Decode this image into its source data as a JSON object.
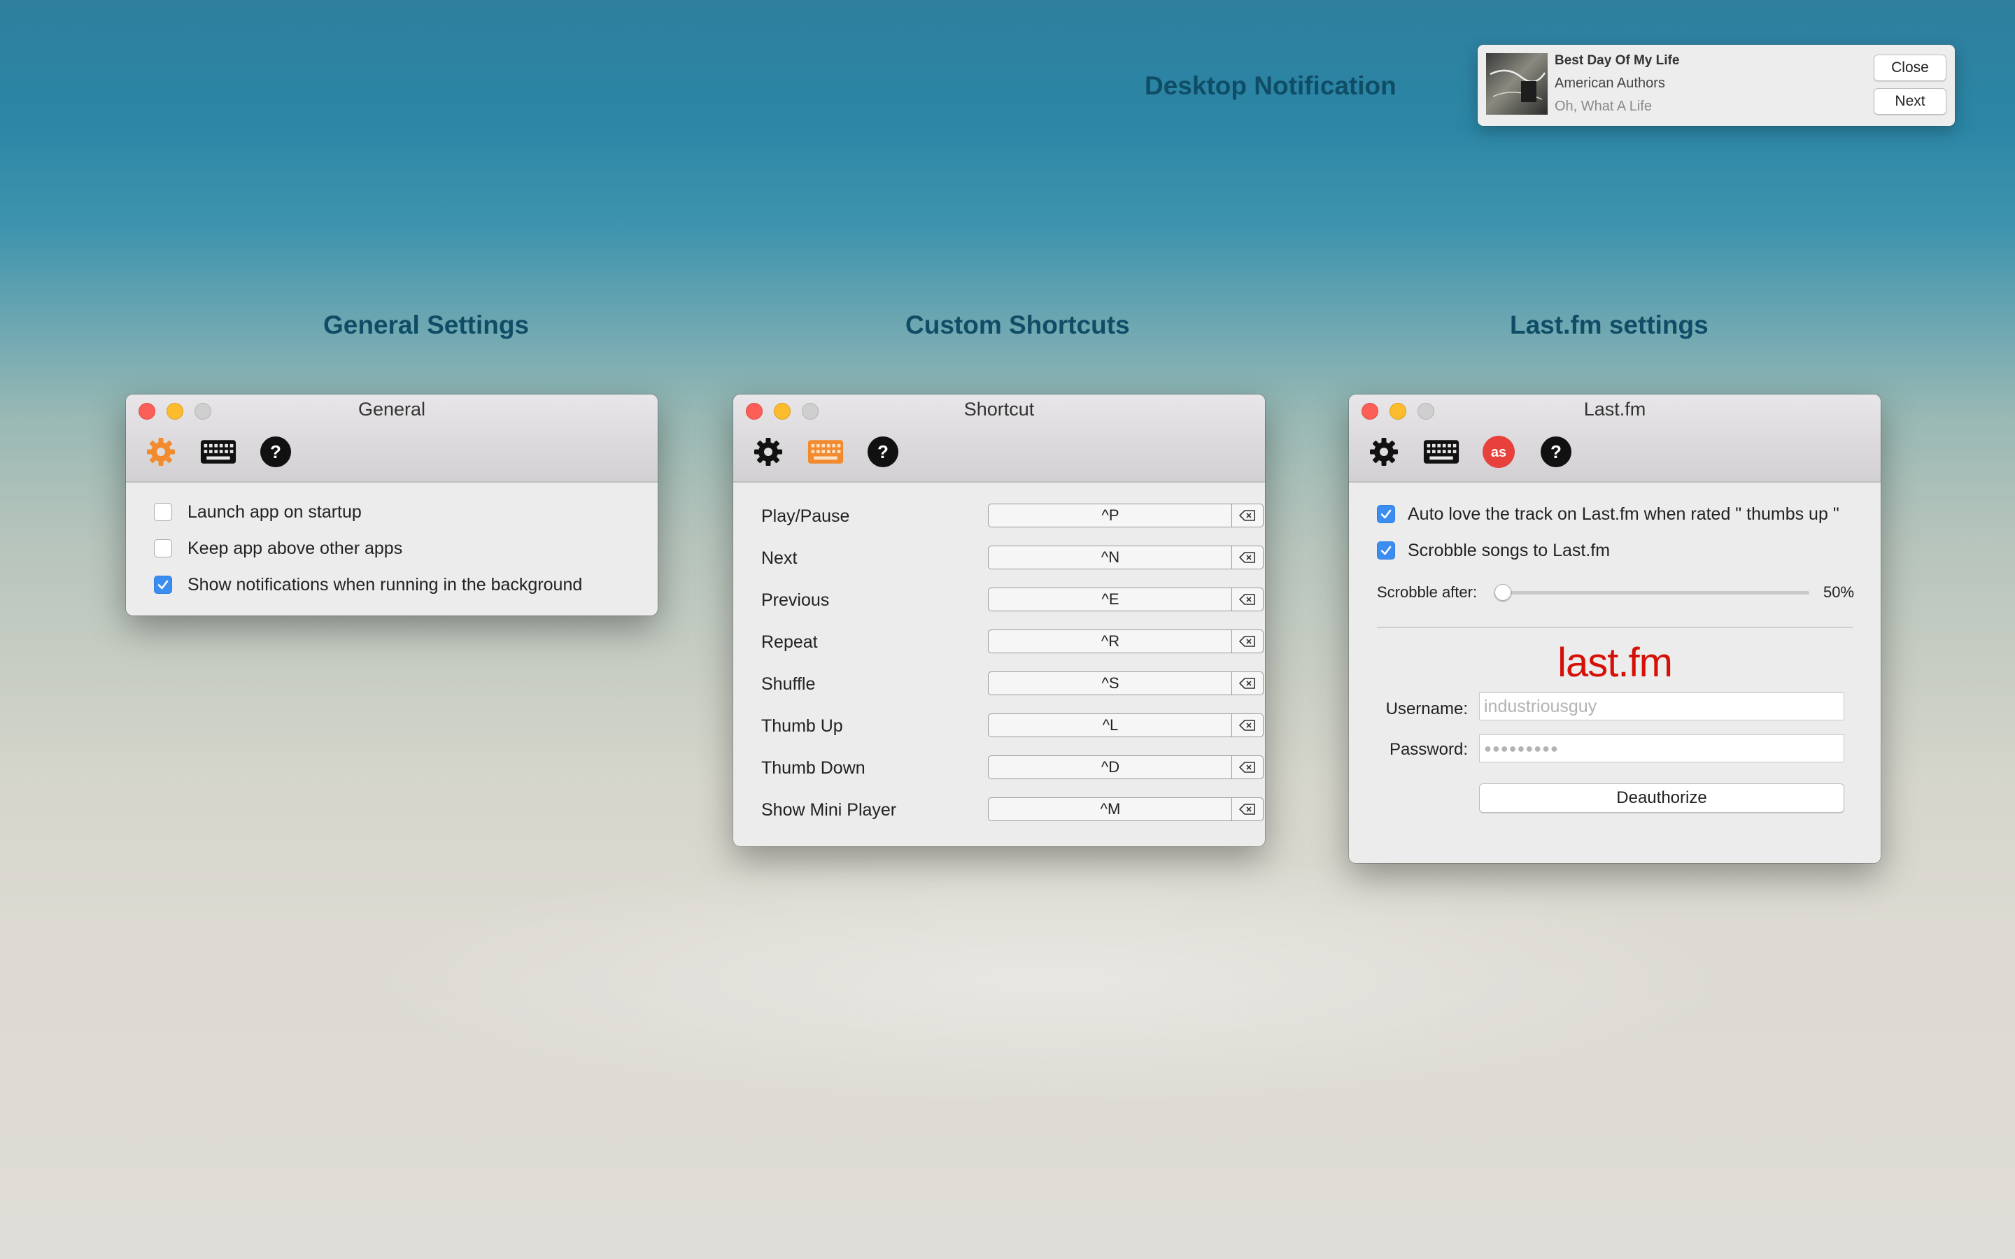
{
  "headings": {
    "notification": "Desktop Notification",
    "general": "General Settings",
    "shortcuts": "Custom Shortcuts",
    "lastfm": "Last.fm settings"
  },
  "notification": {
    "song": "Best Day Of My Life",
    "artist": "American Authors",
    "album": "Oh, What A Life",
    "close_label": "Close",
    "next_label": "Next"
  },
  "general_window": {
    "title": "General",
    "options": [
      {
        "label": "Launch app on startup",
        "checked": false
      },
      {
        "label": "Keep app above other apps",
        "checked": false
      },
      {
        "label": "Show notifications when running in the background",
        "checked": true
      }
    ]
  },
  "shortcut_window": {
    "title": "Shortcut",
    "rows": [
      {
        "label": "Play/Pause",
        "key": "^P"
      },
      {
        "label": "Next",
        "key": "^N"
      },
      {
        "label": "Previous",
        "key": "^E"
      },
      {
        "label": "Repeat",
        "key": "^R"
      },
      {
        "label": "Shuffle",
        "key": "^S"
      },
      {
        "label": "Thumb Up",
        "key": "^L"
      },
      {
        "label": "Thumb Down",
        "key": "^D"
      },
      {
        "label": "Show Mini Player",
        "key": "^M"
      }
    ]
  },
  "lastfm_window": {
    "title": "Last.fm",
    "auto_love_label": "Auto love the track on Last.fm when rated \" thumbs up \"",
    "auto_love_checked": true,
    "scrobble_label": "Scrobble songs to Last.fm",
    "scrobble_checked": true,
    "scrobble_after_label": "Scrobble after:",
    "scrobble_after_value": "50%",
    "scrobble_after_fraction": 0,
    "logo_text": "last.fm",
    "username_label": "Username:",
    "username_value": "industriousguy",
    "password_label": "Password:",
    "password_value": "●●●●●●●●●",
    "deauthorize_label": "Deauthorize"
  },
  "colors": {
    "heading": "#0f4d66",
    "active_tab": "#f28a2e",
    "lastfm_red": "#d51007",
    "checkbox_on": "#3b8ef0"
  }
}
